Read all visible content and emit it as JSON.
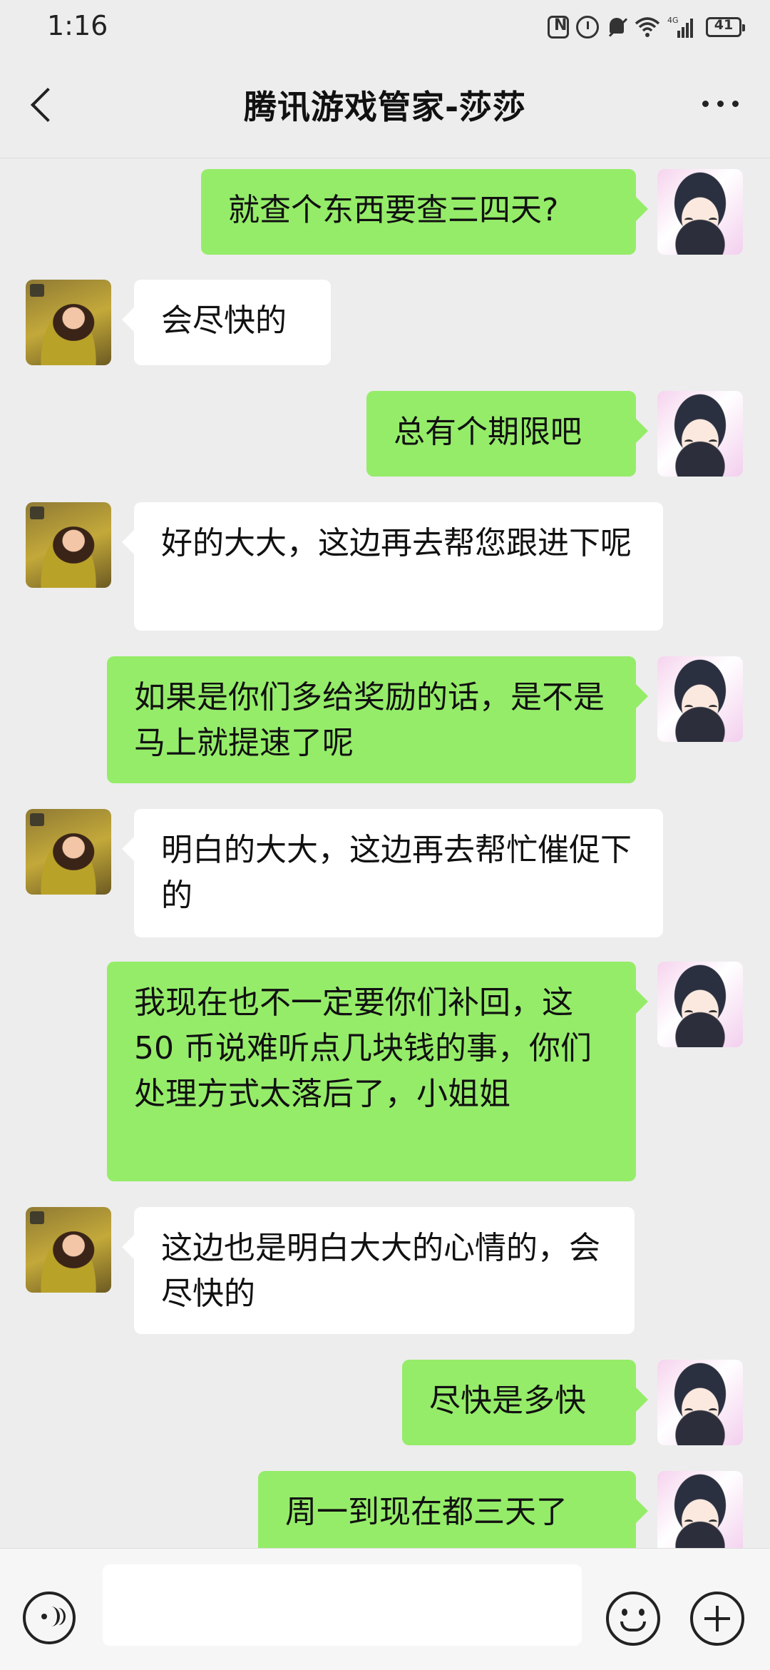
{
  "status_bar": {
    "time": "1:16",
    "network": "4G",
    "battery": "41"
  },
  "header": {
    "title": "腾讯游戏管家-莎莎"
  },
  "messages": [
    {
      "sender": "me",
      "text": "就查个东西要查三四天?"
    },
    {
      "sender": "other",
      "text": "会尽快的"
    },
    {
      "sender": "me",
      "text": "总有个期限吧"
    },
    {
      "sender": "other",
      "text": "好的大大，这边再去帮您跟进下呢"
    },
    {
      "sender": "me",
      "text": "如果是你们多给奖励的话，是不是马上就提速了呢"
    },
    {
      "sender": "other",
      "text": "明白的大大，这边再去帮忙催促下的"
    },
    {
      "sender": "me",
      "text": "我现在也不一定要你们补回，这 50 币说难听点几块钱的事，你们处理方式太落后了，小姐姐"
    },
    {
      "sender": "other",
      "text": "这边也是明白大大的心情的，会尽快的"
    },
    {
      "sender": "me",
      "text": "尽快是多快"
    },
    {
      "sender": "me",
      "text": "周一到现在都三天了"
    }
  ],
  "input_bar": {
    "placeholder": ""
  },
  "colors": {
    "background": "#ededed",
    "my_bubble": "#95ec69",
    "other_bubble": "#ffffff"
  }
}
